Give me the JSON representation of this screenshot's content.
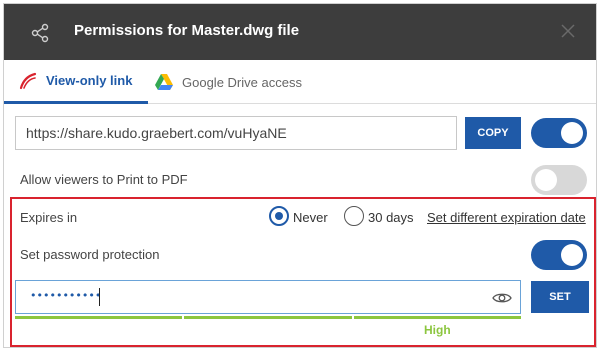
{
  "header": {
    "title": "Permissions for Master.dwg file",
    "share_icon": "share-icon",
    "close_icon": "close-icon"
  },
  "tabs": [
    {
      "label": "View-only link",
      "icon": "kudo-logo-icon",
      "active": true
    },
    {
      "label": "Google Drive access",
      "icon": "google-drive-icon",
      "active": false
    }
  ],
  "link": {
    "url": "https://share.kudo.graebert.com/vuHyaNE",
    "copy_label": "COPY",
    "enabled": true
  },
  "print": {
    "label": "Allow viewers to Print to PDF",
    "enabled": false
  },
  "expiry": {
    "label": "Expires in",
    "options": [
      {
        "label": "Never",
        "selected": true
      },
      {
        "label": "30 days",
        "selected": false
      }
    ],
    "custom_link": "Set different expiration date"
  },
  "password": {
    "label": "Set password protection",
    "enabled": true,
    "masked_value": "•••••••••••",
    "set_label": "SET",
    "strength_label": "High",
    "strength_level": "high"
  },
  "colors": {
    "accent": "#1f5aa8",
    "header_bg": "#3d3d3d",
    "highlight": "#d9232e",
    "strength": "#8cc63f"
  }
}
